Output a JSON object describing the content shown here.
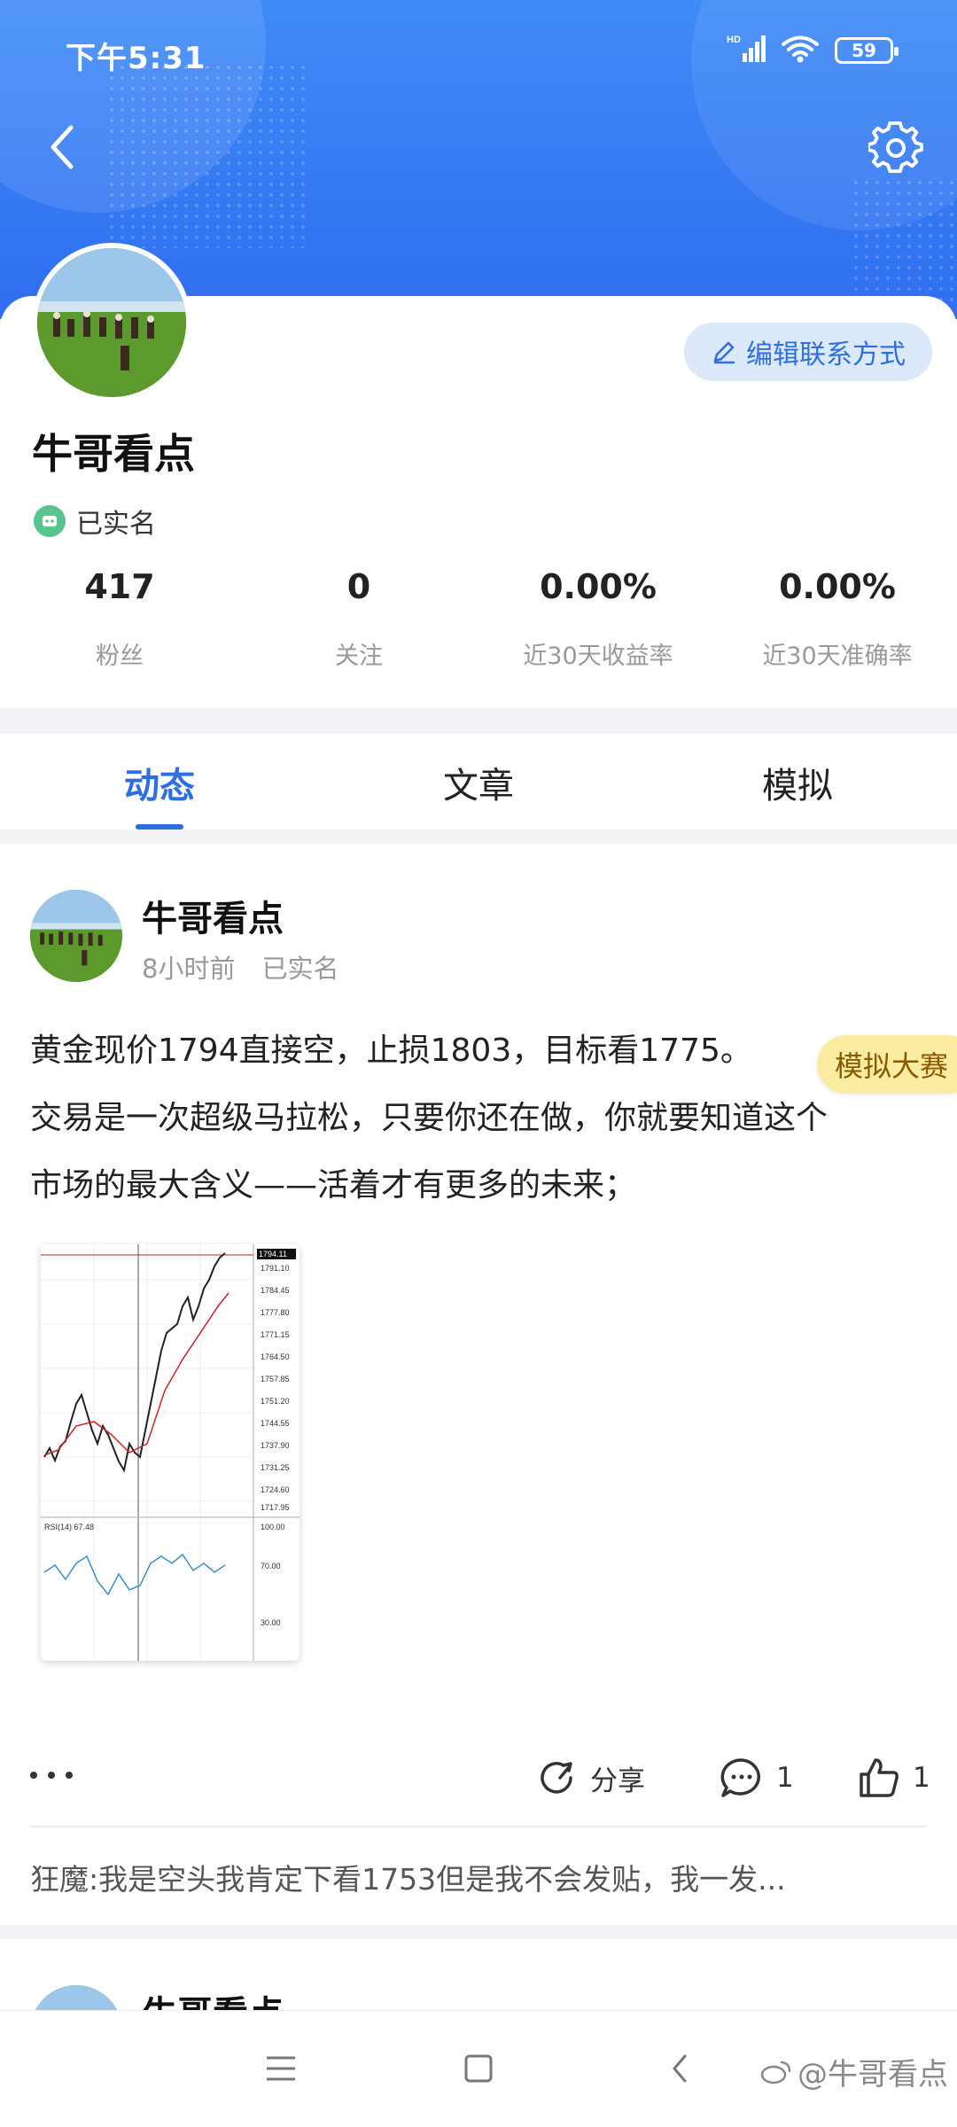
{
  "status_bar": {
    "time": "下午5:31",
    "battery": "59",
    "network": "HD"
  },
  "profile": {
    "name": "牛哥看点",
    "verified_label": "已实名",
    "edit_button": "编辑联系方式"
  },
  "stats": [
    {
      "value": "417",
      "label": "粉丝"
    },
    {
      "value": "0",
      "label": "关注"
    },
    {
      "value": "0.00%",
      "label": "近30天收益率"
    },
    {
      "value": "0.00%",
      "label": "近30天准确率"
    }
  ],
  "tabs": [
    {
      "label": "动态",
      "active": true
    },
    {
      "label": "文章",
      "active": false
    },
    {
      "label": "模拟",
      "active": false
    }
  ],
  "post": {
    "author": "牛哥看点",
    "time": "8小时前",
    "verified": "已实名",
    "text_lines": [
      "黄金现价1794直接空，止损1803，目标看1775。",
      "交易是一次超级马拉松，只要你还在做，你就要知道这个",
      "市场的最大含义——活着才有更多的未来；"
    ],
    "floating_badge": "模拟大赛",
    "share_label": "分享",
    "comment_count": "1",
    "like_count": "1",
    "comment_preview": "狂魔:我是空头我肯定下看1753但是我不会发贴，我一发..."
  },
  "post2": {
    "author": "牛哥看点"
  },
  "watermark": "@牛哥看点",
  "colors": {
    "primary": "#2e6fe0",
    "header": "#3f8bf7",
    "badge": "#fbeca2"
  }
}
